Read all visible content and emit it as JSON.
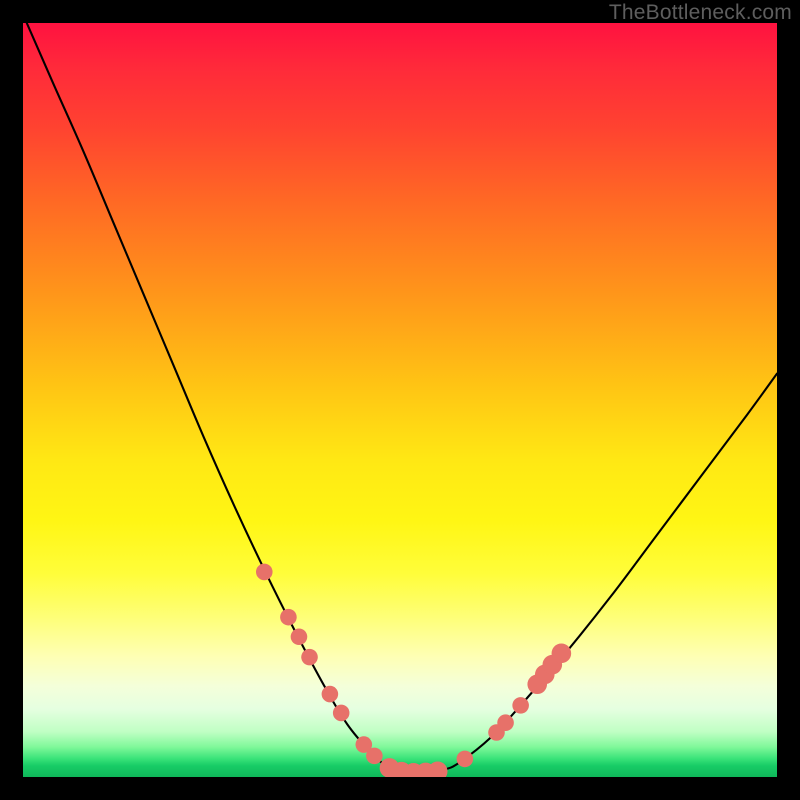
{
  "watermark": "TheBottleneck.com",
  "colors": {
    "frame": "#000000",
    "curve": "#000000",
    "dot": "#e77169"
  },
  "chart_data": {
    "type": "line",
    "title": "",
    "xlabel": "",
    "ylabel": "",
    "xlim": [
      0,
      100
    ],
    "ylim": [
      0,
      100
    ],
    "grid": false,
    "legend": false,
    "series": [
      {
        "name": "bottleneck-curve",
        "x": [
          0.5,
          4,
          8,
          12,
          16,
          20,
          24,
          28,
          32,
          36,
          40,
          43,
          46,
          48,
          50,
          52,
          54,
          56,
          58,
          62,
          66,
          72,
          78,
          84,
          90,
          96,
          100
        ],
        "y": [
          100,
          92,
          83,
          73.5,
          64,
          54.5,
          45,
          36,
          27.5,
          19.5,
          12,
          7,
          3.4,
          1.6,
          0.7,
          0.5,
          0.6,
          1.0,
          2.0,
          5.2,
          9.5,
          16.5,
          24,
          32,
          40,
          48,
          53.5
        ]
      }
    ],
    "markers": [
      {
        "x": 32.0,
        "y": 27.2,
        "r": 1.1
      },
      {
        "x": 35.2,
        "y": 21.2,
        "r": 1.1
      },
      {
        "x": 36.6,
        "y": 18.6,
        "r": 1.1
      },
      {
        "x": 38.0,
        "y": 15.9,
        "r": 1.1
      },
      {
        "x": 40.7,
        "y": 11.0,
        "r": 1.1
      },
      {
        "x": 42.2,
        "y": 8.5,
        "r": 1.1
      },
      {
        "x": 45.2,
        "y": 4.3,
        "r": 1.1
      },
      {
        "x": 46.6,
        "y": 2.8,
        "r": 1.1
      },
      {
        "x": 48.6,
        "y": 1.2,
        "r": 1.3
      },
      {
        "x": 50.2,
        "y": 0.7,
        "r": 1.3
      },
      {
        "x": 51.8,
        "y": 0.55,
        "r": 1.3
      },
      {
        "x": 53.4,
        "y": 0.6,
        "r": 1.3
      },
      {
        "x": 55.0,
        "y": 0.75,
        "r": 1.3
      },
      {
        "x": 58.6,
        "y": 2.4,
        "r": 1.1
      },
      {
        "x": 62.8,
        "y": 5.9,
        "r": 1.1
      },
      {
        "x": 64.0,
        "y": 7.2,
        "r": 1.1
      },
      {
        "x": 66.0,
        "y": 9.5,
        "r": 1.1
      },
      {
        "x": 68.2,
        "y": 12.3,
        "r": 1.3
      },
      {
        "x": 69.2,
        "y": 13.6,
        "r": 1.3
      },
      {
        "x": 70.2,
        "y": 14.9,
        "r": 1.3
      },
      {
        "x": 71.4,
        "y": 16.4,
        "r": 1.3
      }
    ]
  }
}
